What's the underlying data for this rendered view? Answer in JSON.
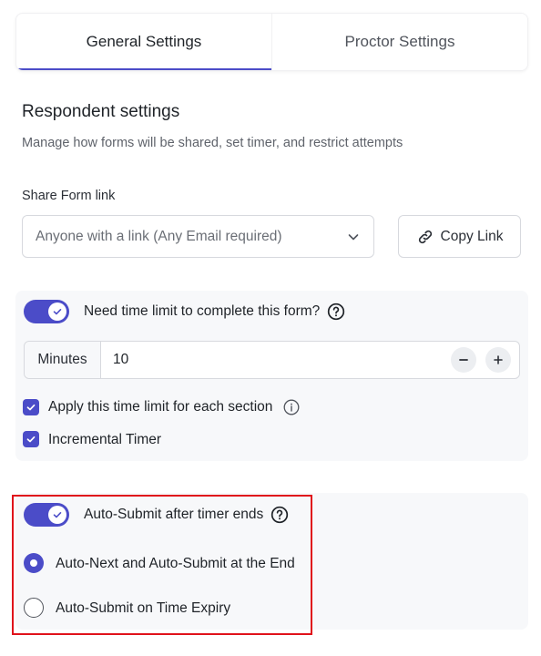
{
  "tabs": [
    {
      "label": "General Settings",
      "active": true
    },
    {
      "label": "Proctor Settings",
      "active": false
    }
  ],
  "section": {
    "title": "Respondent settings",
    "description": "Manage how forms will be shared, set timer, and restrict attempts"
  },
  "share": {
    "label": "Share Form link",
    "selected": "Anyone with a link (Any Email required)",
    "copy_label": "Copy Link"
  },
  "timer": {
    "toggle_on": true,
    "question": "Need time limit to complete this form?",
    "unit_label": "Minutes",
    "value": "10",
    "options": [
      {
        "label": "Apply this time limit for each section",
        "checked": true
      },
      {
        "label": "Incremental Timer",
        "checked": true
      }
    ]
  },
  "auto_submit": {
    "toggle_on": true,
    "label": "Auto-Submit after timer ends",
    "radios": [
      {
        "label": "Auto-Next and Auto-Submit at the End",
        "selected": true
      },
      {
        "label": "Auto-Submit on Time Expiry",
        "selected": false
      }
    ]
  },
  "colors": {
    "accent": "#4b4cc8",
    "highlight": "#e0121b",
    "panel_bg": "#f7f8fa"
  }
}
